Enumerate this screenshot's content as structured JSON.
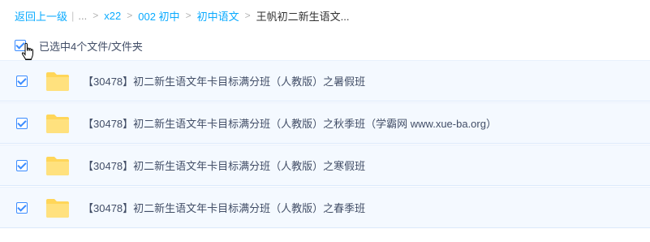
{
  "breadcrumb": {
    "back_label": "返回上一级",
    "ellipsis": "...",
    "items": [
      "x22",
      "002 初中",
      "初中语文"
    ],
    "current": "王帆初二新生语文..."
  },
  "selection": {
    "label": "已选中4个文件/文件夹",
    "all_checked": true
  },
  "files": [
    {
      "name": "【30478】初二新生语文年卡目标满分班（人教版）之暑假班",
      "type": "folder",
      "checked": true
    },
    {
      "name": "【30478】初二新生语文年卡目标满分班（人教版）之秋季班（学霸网 www.xue-ba.org）",
      "type": "folder",
      "checked": true
    },
    {
      "name": "【30478】初二新生语文年卡目标满分班（人教版）之寒假班",
      "type": "folder",
      "checked": true
    },
    {
      "name": "【30478】初二新生语文年卡目标满分班（人教版）之春季班",
      "type": "folder",
      "checked": true
    }
  ],
  "colors": {
    "link": "#09aaff",
    "checkbox": "#3b8cff",
    "row_bg": "#f4f9ff",
    "folder": "#ffd659"
  },
  "icons": {
    "folder": "folder-icon",
    "cursor": "hand-pointer-icon"
  }
}
